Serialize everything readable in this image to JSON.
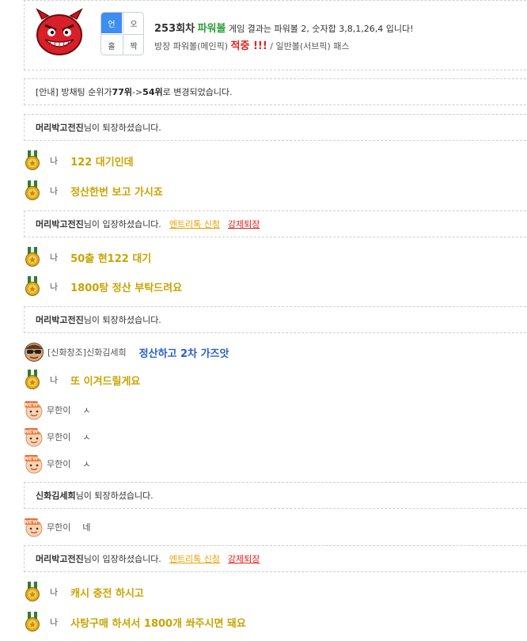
{
  "result": {
    "round": "253회차",
    "game_name": "파워볼",
    "result_text": " 게임 결과는 파워볼 2, 숫자합 3,8,1,26,4 입니다!",
    "host_prefix": "방장 파워볼(메인픽) ",
    "host_hit": "적중 !!!",
    "host_suffix": " / 일반볼(서브픽) 패스",
    "grid": {
      "odd": "오",
      "even": "짝",
      "un": "언",
      "over": "홀"
    }
  },
  "notice": {
    "prefix": "[안내] 방채팅 순위가 ",
    "from": "77위",
    "arrow": " -> ",
    "to": "54위",
    "suffix": " 로 변경되었습니다."
  },
  "links": {
    "entry": "엔트리톡 신청",
    "kick": "강제퇴장"
  },
  "system_messages": [
    {
      "user": "머리박고전진",
      "text": "님이 퇴장하셨습니다."
    },
    {
      "user": "머리박고전진",
      "text": "님이 입장하셨습니다."
    },
    {
      "user": "머리박고전진",
      "text": "님이 퇴장하셨습니다."
    },
    {
      "user": "신화김세희",
      "text": "님이 퇴장하셨습니다."
    },
    {
      "user": "머리박고전진",
      "text": "님이 입장하셨습니다."
    }
  ],
  "messages": [
    {
      "who": "나",
      "text": "122 대기인데"
    },
    {
      "who": "나",
      "text": "정산한번 보고 가시죠"
    },
    {
      "who": "나",
      "text": "50출 현122 대기"
    },
    {
      "who": "나",
      "text": "1800탕 정산 부탁드려요"
    },
    {
      "who": "[신화창조]신화김세희",
      "text": "정산하고 2차 가즈앗"
    },
    {
      "who": "나",
      "text": "또 이겨드릴게요"
    },
    {
      "who": "무한이",
      "text": "ㅅ"
    },
    {
      "who": "무한이",
      "text": "ㅅ"
    },
    {
      "who": "무한이",
      "text": "ㅅ"
    },
    {
      "who": "무한이",
      "text": "네"
    },
    {
      "who": "나",
      "text": "캐시 충전 하시고"
    },
    {
      "who": "나",
      "text": "사탕구매 하셔서 1800개 쏴주시면 돼요"
    }
  ],
  "icons": {
    "host_avatar": "red-devil-icon",
    "medal": "gold-medal-icon",
    "sunglasses": "sunglasses-face-icon",
    "new_user": "new-user-face-icon"
  },
  "colors": {
    "gold_text": "#c9a400",
    "blue_text": "#2a5fc8",
    "green_game": "#2e9e3a",
    "red_hit": "#e02020",
    "selected_cell": "#3d8ef0"
  }
}
